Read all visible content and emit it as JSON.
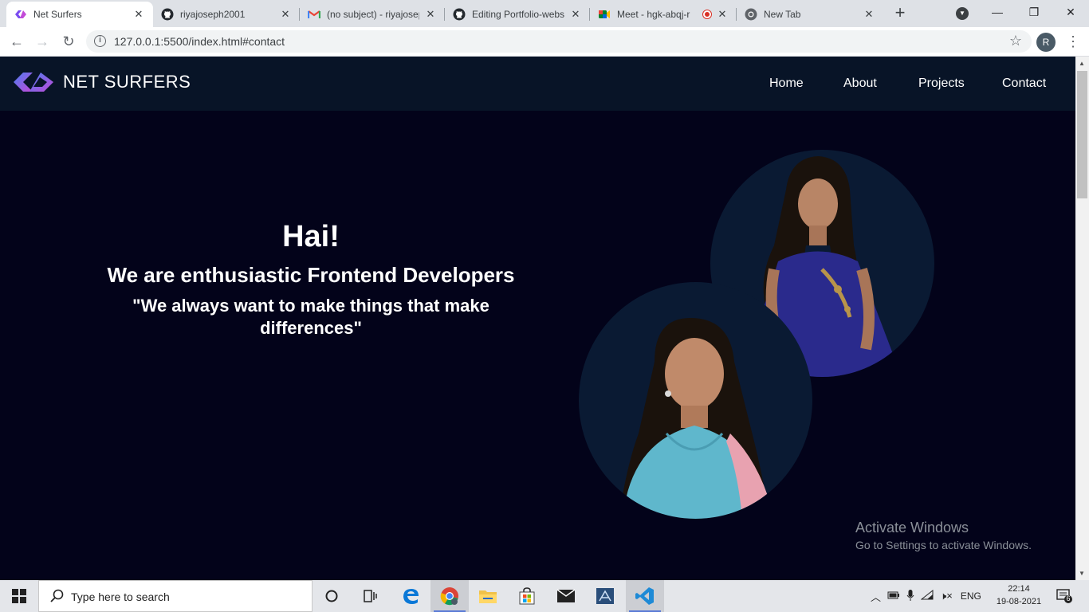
{
  "browser": {
    "tabs": [
      {
        "title": "Net Surfers",
        "icon": "net-surfers-favicon",
        "active": true
      },
      {
        "title": "riyajoseph2001",
        "icon": "github-icon"
      },
      {
        "title": "(no subject) - riyajosep",
        "icon": "gmail-icon"
      },
      {
        "title": "Editing Portfolio-webs",
        "icon": "github-icon"
      },
      {
        "title": "Meet - hgk-abqj-r",
        "icon": "google-meet-icon",
        "recording": true
      },
      {
        "title": "New Tab",
        "icon": "chrome-icon"
      }
    ],
    "url": "127.0.0.1:5500/index.html#contact",
    "profile_initial": "R"
  },
  "site": {
    "brand": "NET SURFERS",
    "nav": [
      "Home",
      "About",
      "Projects",
      "Contact"
    ],
    "hero": {
      "title": "Hai!",
      "subtitle": "We are enthusiastic Frontend Developers",
      "quote": "\"We always want to make things that make differences\""
    }
  },
  "watermark": {
    "line1": "Activate Windows",
    "line2": "Go to Settings to activate Windows."
  },
  "taskbar": {
    "search_placeholder": "Type here to search",
    "language": "ENG",
    "time": "22:14",
    "date": "19-08-2021",
    "notification_count": "6"
  },
  "colors": {
    "page_bg": "#03031a",
    "navbar_bg": "#081427",
    "circle_bg": "#0a1a33",
    "logo_gradient_start": "#5b4cf0",
    "logo_gradient_end": "#c24bd8"
  }
}
